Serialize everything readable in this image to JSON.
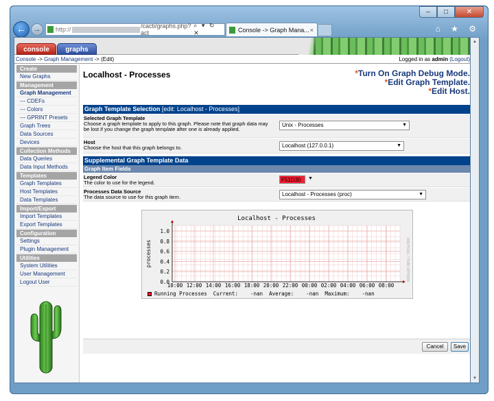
{
  "browser": {
    "address_prefix": "http://",
    "address_path": "/cacti/graphs.php?act",
    "address_tools": "⌕ ▾ ↻ ✕",
    "tab_title": "Console -> Graph Mana...",
    "tab_close": "×",
    "nav_icons": "⌂ ★ ⚙",
    "win_min": "–",
    "win_max": "□",
    "win_close": "✕"
  },
  "header": {
    "tabs": [
      "console",
      "graphs"
    ],
    "breadcrumb": {
      "console": "Console",
      "sep1": " -> ",
      "graph_management": "Graph Management",
      "sep2": " -> ",
      "current": "(Edit)"
    },
    "login": {
      "prefix": "Logged in as ",
      "user": "admin",
      "logout": "(Logout)"
    }
  },
  "sidebar": {
    "sections": [
      {
        "title": "Create",
        "items": [
          "New Graphs"
        ]
      },
      {
        "title": "Management",
        "items": [
          "Graph Management",
          "--- CDEFs",
          "--- Colors",
          "--- GPRINT Presets",
          "Graph Trees",
          "Data Sources",
          "Devices"
        ]
      },
      {
        "title": "Collection Methods",
        "items": [
          "Data Queries",
          "Data Input Methods"
        ]
      },
      {
        "title": "Templates",
        "items": [
          "Graph Templates",
          "Host Templates",
          "Data Templates"
        ]
      },
      {
        "title": "Import/Export",
        "items": [
          "Import Templates",
          "Export Templates"
        ]
      },
      {
        "title": "Configuration",
        "items": [
          "Settings",
          "Plugin Management"
        ]
      },
      {
        "title": "Utilities",
        "items": [
          "System Utilities",
          "User Management",
          "Logout User"
        ]
      }
    ]
  },
  "page": {
    "title": "Localhost - Processes",
    "links": [
      "Turn On Graph Debug Mode.",
      "Edit Graph Template.",
      "Edit Host."
    ],
    "link_star": "*"
  },
  "template_section": {
    "title": "Graph Template Selection",
    "edit": "[edit: Localhost - Processes]",
    "selected_label": "Selected Graph Template",
    "selected_desc": "Choose a graph template to apply to this graph. Please note that graph data may be lost if you change the graph template after one is already applied.",
    "selected_value": "Unix - Processes",
    "host_label": "Host",
    "host_desc": "Choose the host that this graph belongs to.",
    "host_value": "Localhost (127.0.0.1)"
  },
  "supplemental": {
    "title": "Supplemental Graph Template Data",
    "subtitle": "Graph Item Fields",
    "legend_color_label": "Legend Color",
    "legend_color_desc": "The color to use for the legend.",
    "legend_color_value": "F51D30",
    "legend_color_hex": "#f51d30",
    "ds_label": "Processes Data Source",
    "ds_desc": "The data source to use for this graph item.",
    "ds_value": "Localhost - Processes (proc)"
  },
  "graph": {
    "legend_text": "Running Processes  Current:    -nan  Average:    -nan  Maximum:    -nan",
    "watermark": "RRDTOOL / TOBI OETIKER"
  },
  "chart_data": {
    "type": "line",
    "title": "Localhost - Processes",
    "ylabel": "processes",
    "xlabel": "",
    "ylim": [
      0,
      1.0
    ],
    "y_ticks": [
      "0.0",
      "0.2",
      "0.4",
      "0.6",
      "0.8",
      "1.0"
    ],
    "x_ticks": [
      "10:00",
      "12:00",
      "14:00",
      "16:00",
      "18:00",
      "20:00",
      "22:00",
      "00:00",
      "02:00",
      "04:00",
      "06:00",
      "08:00"
    ],
    "series": [
      {
        "name": "Running Processes",
        "values": []
      }
    ],
    "grid": true
  },
  "buttons": {
    "cancel": "Cancel",
    "save": "Save"
  }
}
